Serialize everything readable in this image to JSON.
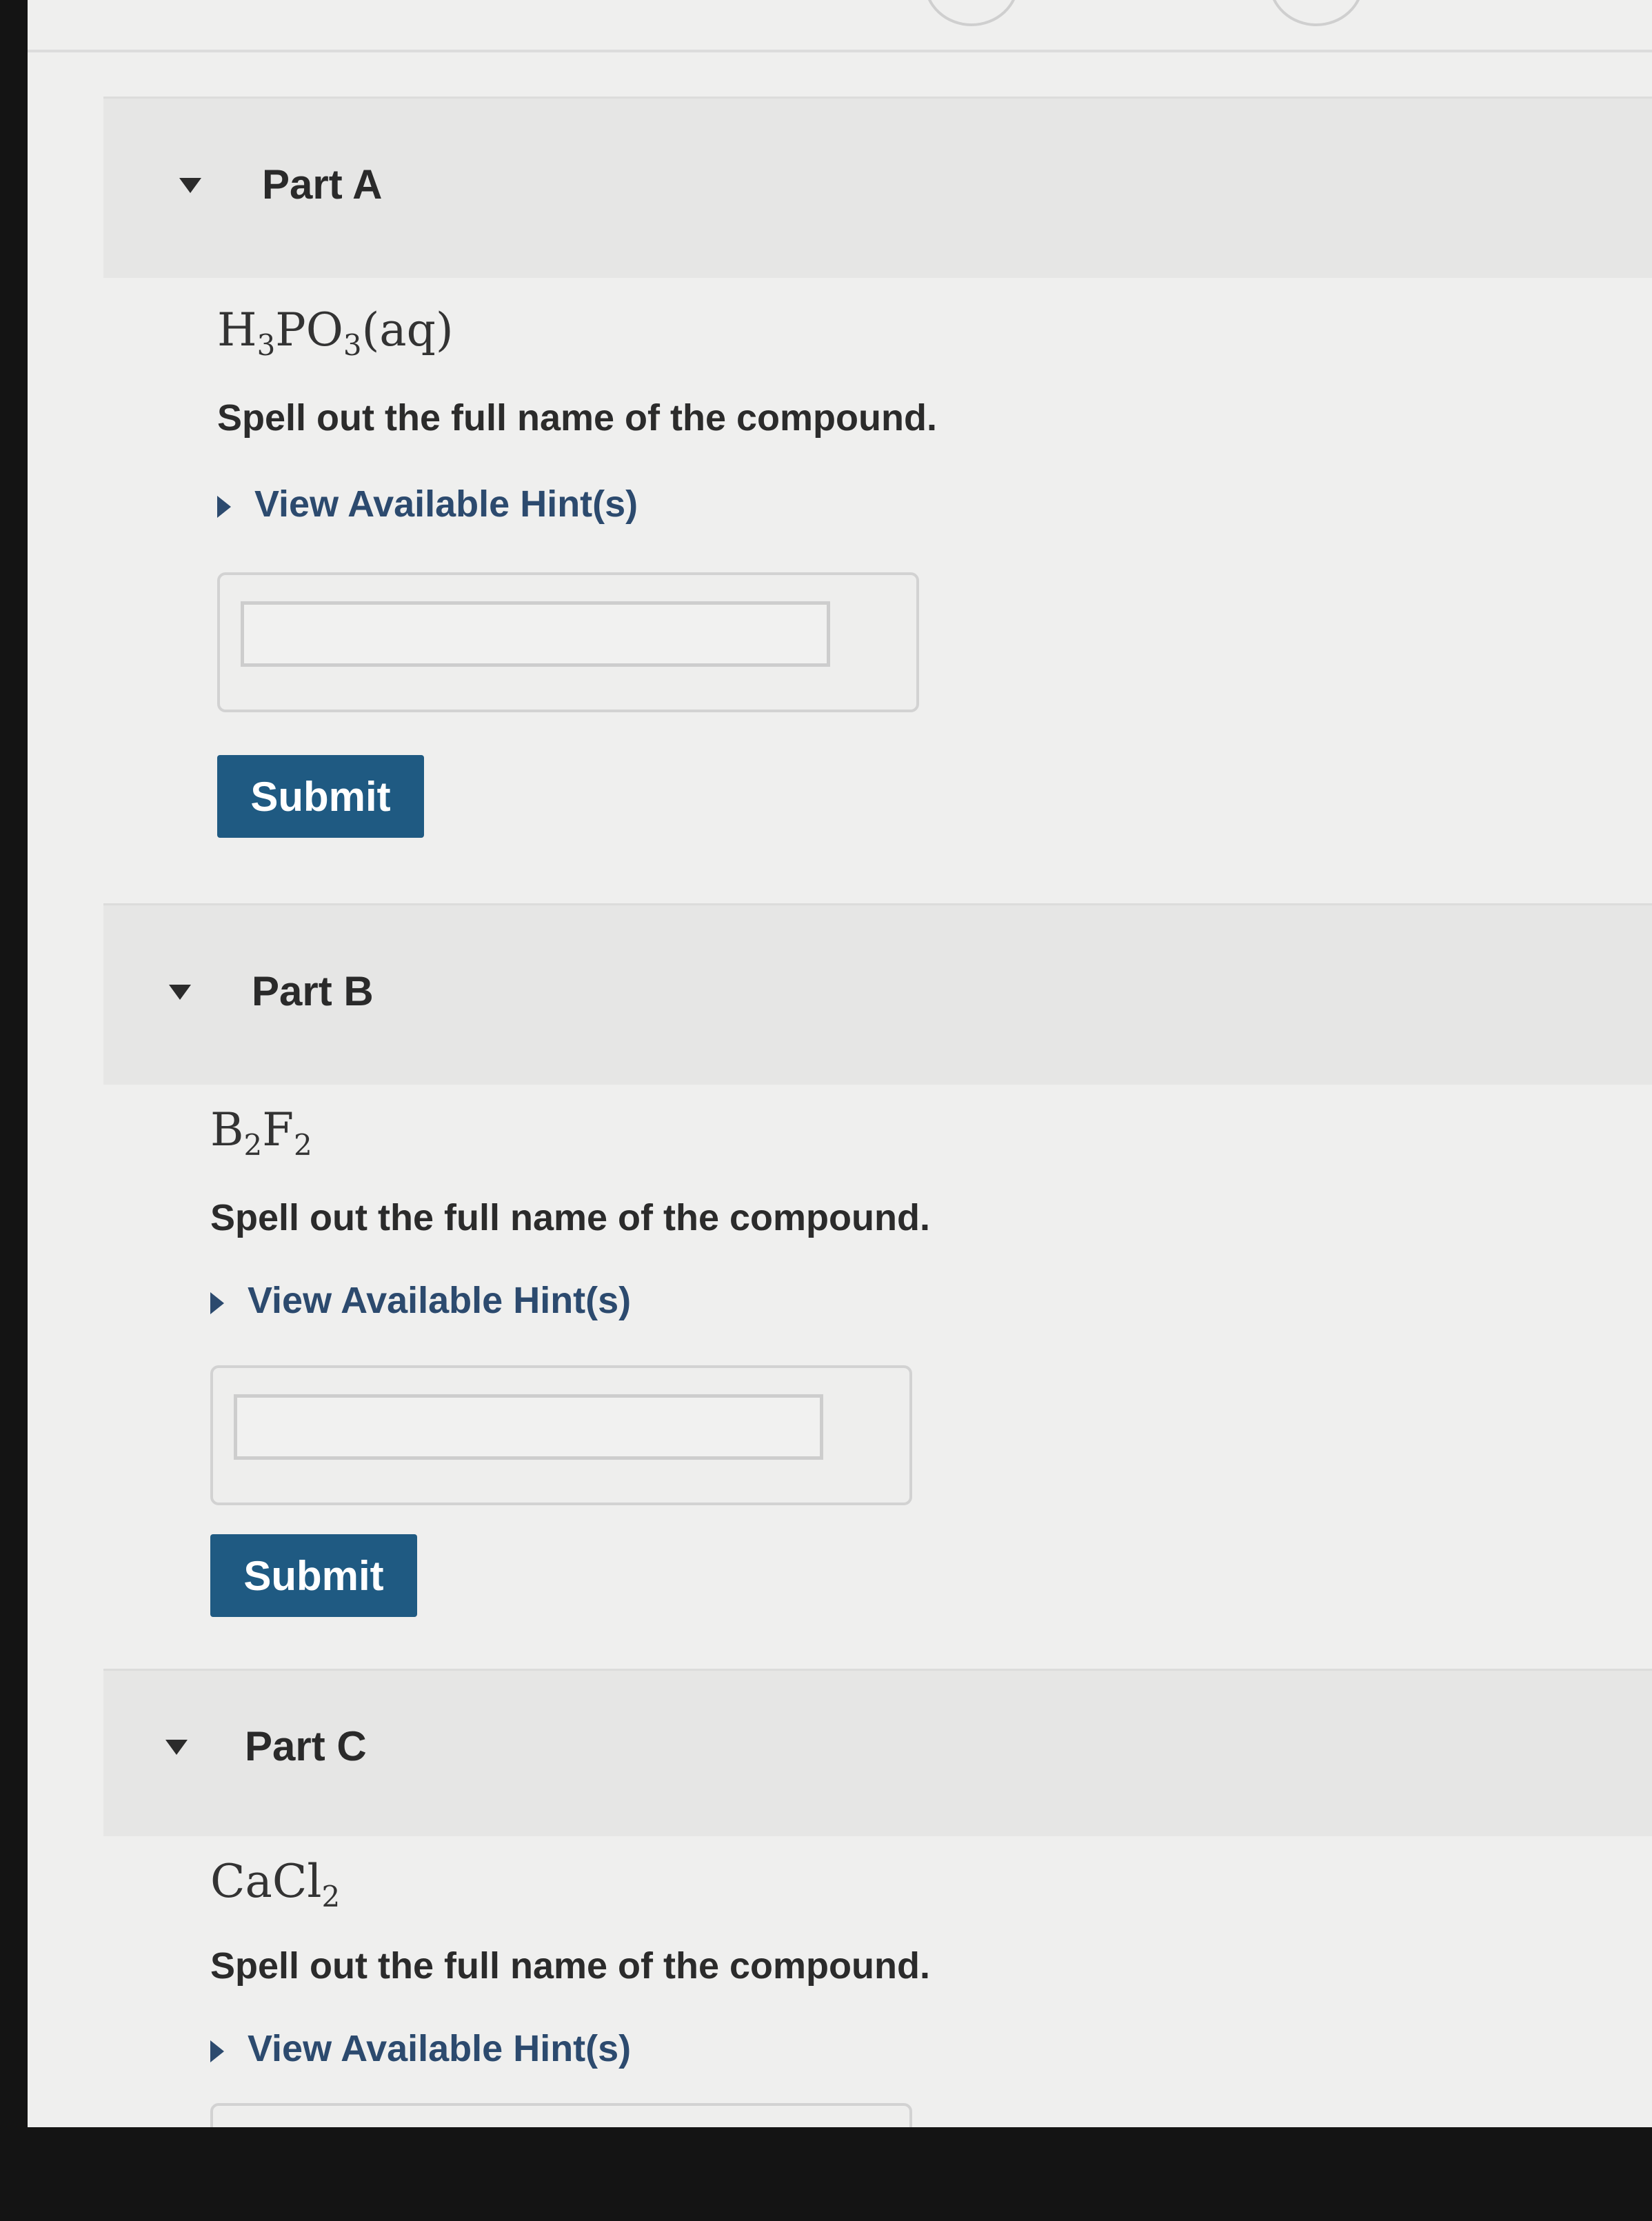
{
  "parts": [
    {
      "title": "Part A",
      "formula": {
        "s1": "H",
        "n1": "3",
        "s2": "PO",
        "n2": "3",
        "s3": "(aq)"
      },
      "instruction": "Spell out the full name of the compound.",
      "hint_label": "View Available Hint(s)",
      "answer_value": "",
      "submit_label": "Submit"
    },
    {
      "title": "Part B",
      "formula": {
        "s1": "B",
        "n1": "2",
        "s2": "F",
        "n2": "2",
        "s3": ""
      },
      "instruction": "Spell out the full name of the compound.",
      "hint_label": "View Available Hint(s)",
      "answer_value": "",
      "submit_label": "Submit"
    },
    {
      "title": "Part C",
      "formula": {
        "s1": "CaCl",
        "n1": "2",
        "s2": "",
        "n2": "",
        "s3": ""
      },
      "instruction": "Spell out the full name of the compound.",
      "hint_label": "View Available Hint(s)",
      "answer_value": ""
    }
  ]
}
